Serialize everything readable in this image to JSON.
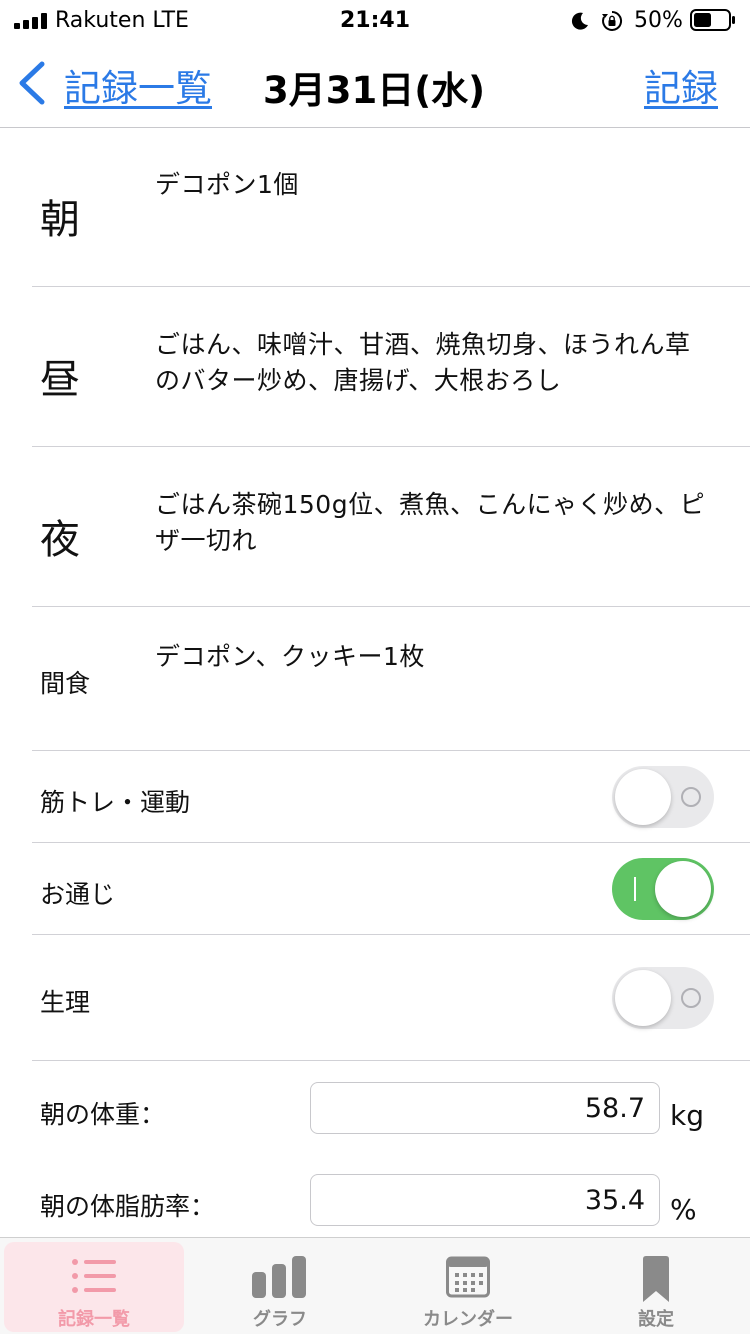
{
  "status_bar": {
    "carrier": "Rakuten  LTE",
    "time": "21:41",
    "battery": "50%",
    "icons": [
      "signal-icon",
      "moon-icon",
      "orientation-lock-icon",
      "battery-icon"
    ]
  },
  "nav": {
    "back_label": "記録一覧",
    "title": "3月31日(水)",
    "action_label": "記録",
    "accent_color": "#2b7ae6"
  },
  "meals": [
    {
      "label": "朝",
      "text": "デコポン1個"
    },
    {
      "label": "昼",
      "text": "ごはん、味噌汁、甘酒、焼魚切身、ほうれん草のバター炒め、唐揚げ、大根おろし"
    },
    {
      "label": "夜",
      "text": "ごはん茶碗150g位、煮魚、こんにゃく炒め、ピザ一切れ"
    },
    {
      "label": "間食",
      "text": "デコポン、クッキー1枚"
    }
  ],
  "toggles": [
    {
      "label": "筋トレ・運動",
      "on": false
    },
    {
      "label": "お通じ",
      "on": true
    },
    {
      "label": "生理",
      "on": false
    }
  ],
  "measurements": [
    {
      "label": "朝の体重：",
      "value": "58.7",
      "unit": "kg"
    },
    {
      "label": "朝の体脂肪率：",
      "value": "35.4",
      "unit": "%"
    }
  ],
  "tabs": [
    {
      "label": "記録一覧",
      "icon": "list-icon",
      "active": true
    },
    {
      "label": "グラフ",
      "icon": "bar-chart-icon",
      "active": false
    },
    {
      "label": "カレンダー",
      "icon": "calendar-icon",
      "active": false
    },
    {
      "label": "設定",
      "icon": "bookmark-icon",
      "active": false
    }
  ],
  "colors": {
    "switch_on": "#5fc464",
    "tab_active": "#f29aa9",
    "tab_active_bg": "#fce6ea"
  }
}
